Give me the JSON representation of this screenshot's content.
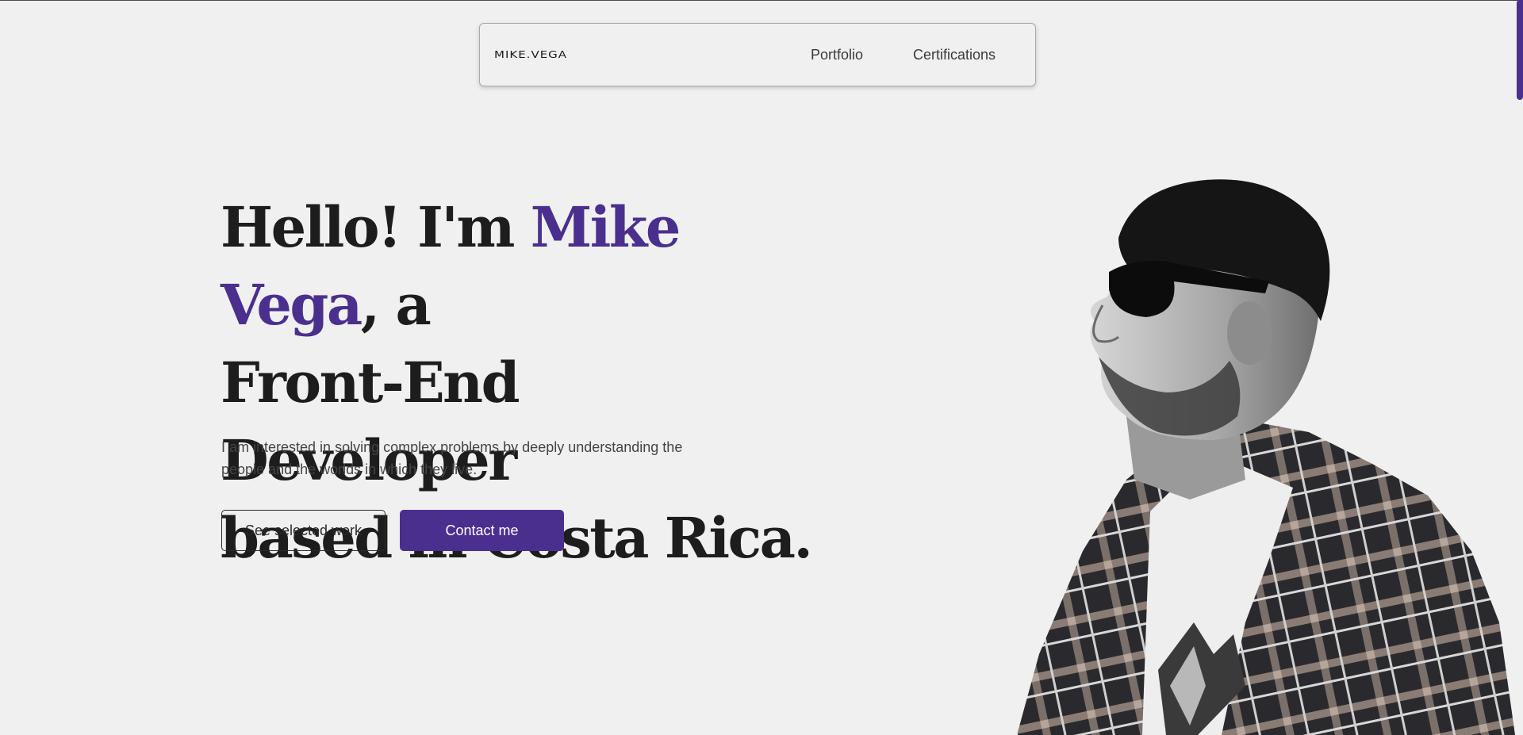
{
  "nav": {
    "logo": "MIKE.VEGA",
    "links": [
      "Portfolio",
      "Certifications"
    ]
  },
  "hero": {
    "title_pre": "Hello! I'm ",
    "title_name": "Mike Vega",
    "title_post_line1": ", a",
    "title_line2": "Front-End Developer",
    "title_line3": "based in Costa Rica.",
    "subtitle": "I am interested in solving complex problems by deeply understanding the people and the worlds in which they live.",
    "buttons": {
      "secondary": "See selected work",
      "primary": "Contact me"
    }
  },
  "colors": {
    "accent": "#4b2f8f",
    "background": "#f0f0f0",
    "text": "#1d1d1d"
  },
  "image": {
    "icon": "portrait-photo"
  }
}
